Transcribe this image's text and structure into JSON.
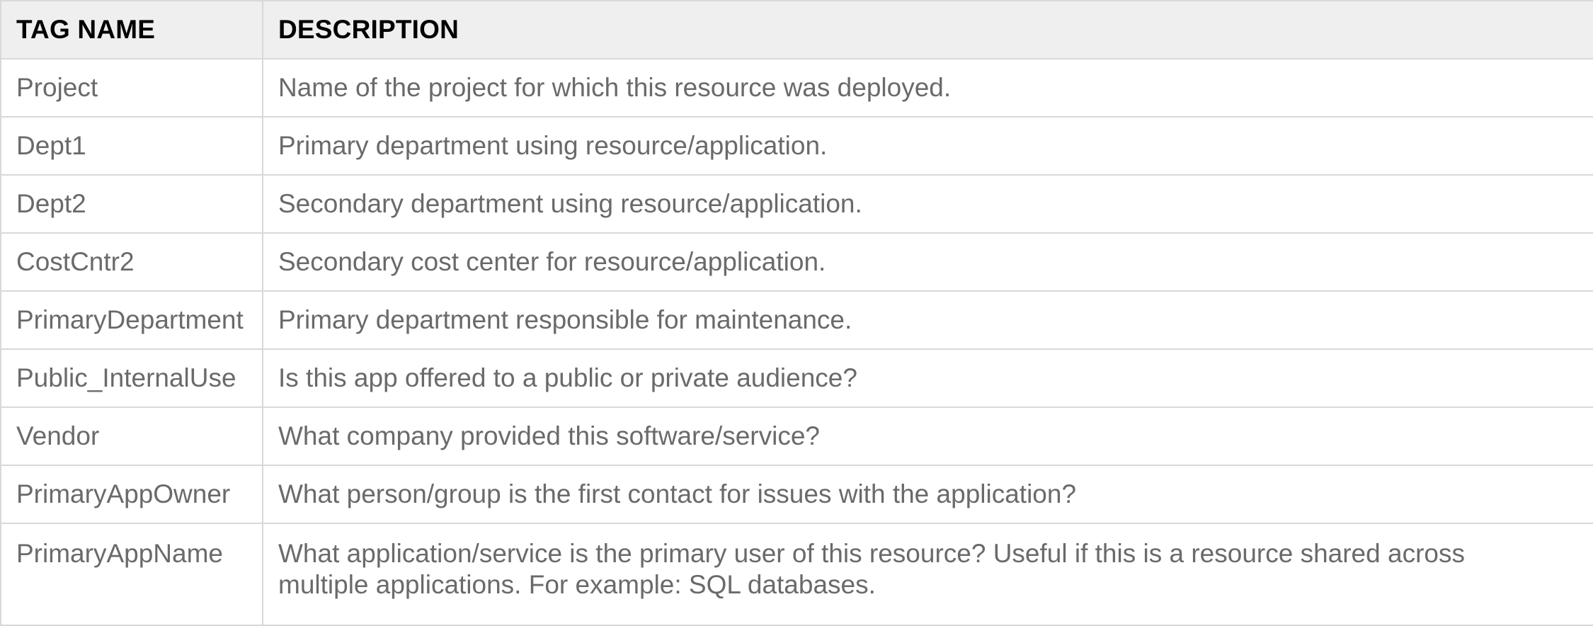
{
  "table": {
    "headers": {
      "tag_name": "TAG NAME",
      "description": "DESCRIPTION"
    },
    "rows": [
      {
        "tag": "Project",
        "description": "Name of the project for which this resource was deployed."
      },
      {
        "tag": "Dept1",
        "description": "Primary department using resource/application."
      },
      {
        "tag": "Dept2",
        "description": "Secondary department using resource/application."
      },
      {
        "tag": "CostCntr2",
        "description": "Secondary cost center for resource/application."
      },
      {
        "tag": "PrimaryDepartment",
        "description": "Primary department responsible for maintenance."
      },
      {
        "tag": "Public_InternalUse",
        "description": "Is this app offered to a public or private audience?"
      },
      {
        "tag": "Vendor",
        "description": "What company provided this software/service?"
      },
      {
        "tag": "PrimaryAppOwner",
        "description": "What person/group is the first contact for issues with the application?"
      },
      {
        "tag": "PrimaryAppName",
        "description": "What application/service is the primary user of this resource? Useful if this is a resource shared across multiple applications. For example: SQL databases."
      }
    ]
  },
  "colors": {
    "header_background": "#efefef",
    "border": "#d8d8d8",
    "header_text": "#000000",
    "body_text": "#6a6a6a"
  }
}
